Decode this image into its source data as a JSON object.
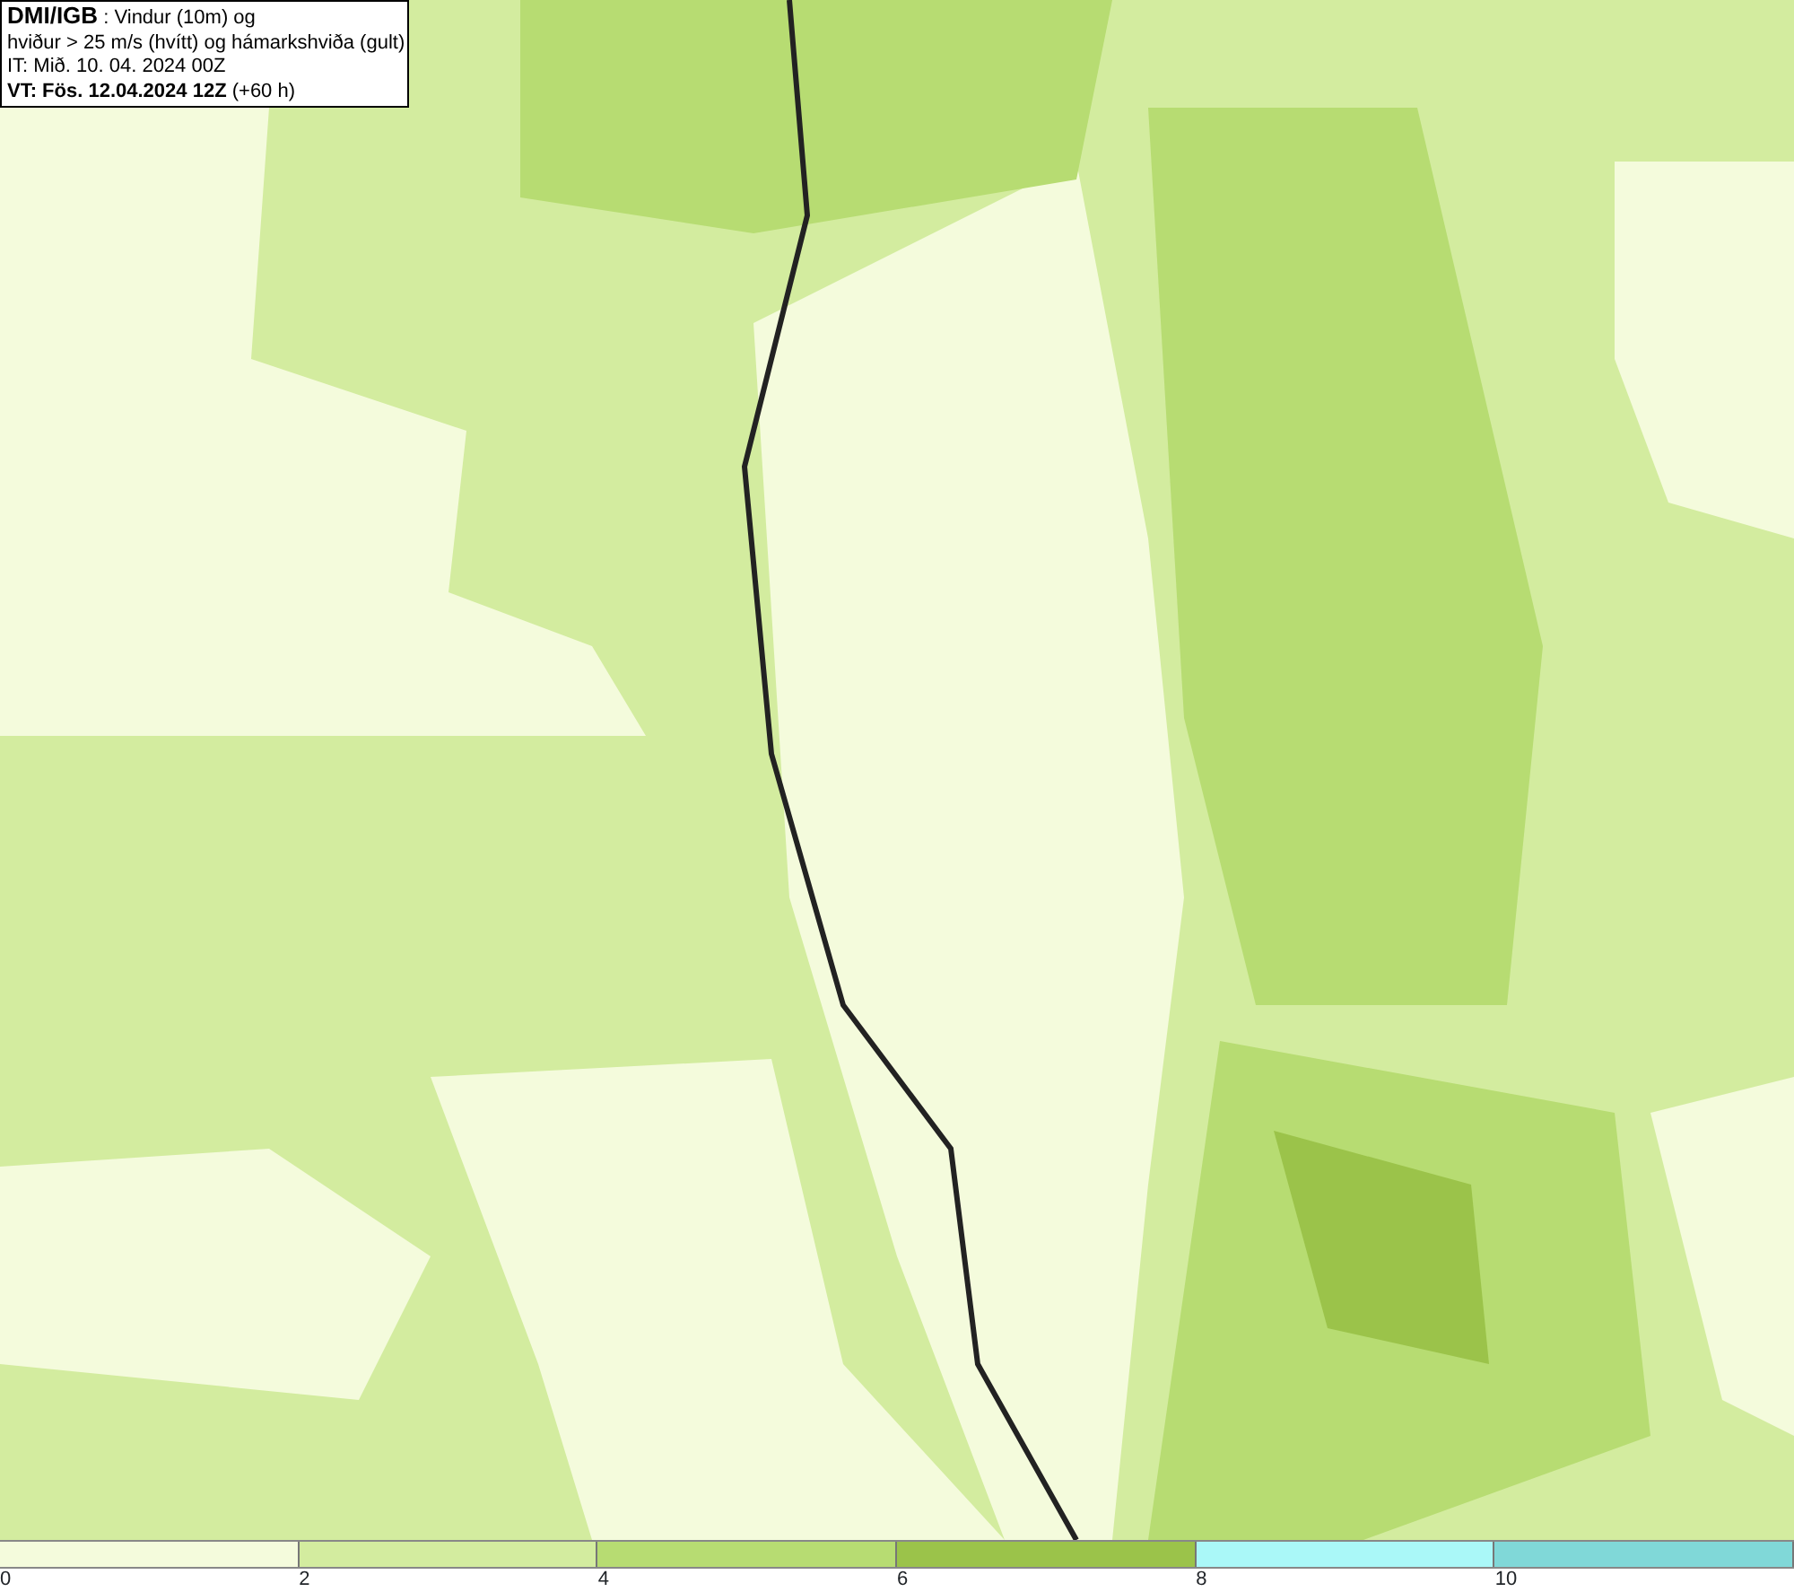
{
  "header": {
    "source": "DMI/IGB",
    "title_rest": " : Vindur (10m) og",
    "line_2": "hviður > 25 m/s (hvítt) og hámarkshviða (gult)",
    "line_3": "IT: Mið. 10. 04. 2024 00Z",
    "valid_time": "VT: Fös. 12.04.2024 12Z",
    "lead": " (+60 h)"
  },
  "legend": {
    "bins": [
      {
        "color": "#f4fbdc"
      },
      {
        "color": "#d3ec9f"
      },
      {
        "color": "#b7dc72"
      },
      {
        "color": "#9bc34a"
      },
      {
        "color": "#aaf8f8"
      },
      {
        "color": "#80d8d8"
      }
    ],
    "ticks": [
      "0",
      "2",
      "4",
      "6",
      "8",
      "10"
    ]
  }
}
